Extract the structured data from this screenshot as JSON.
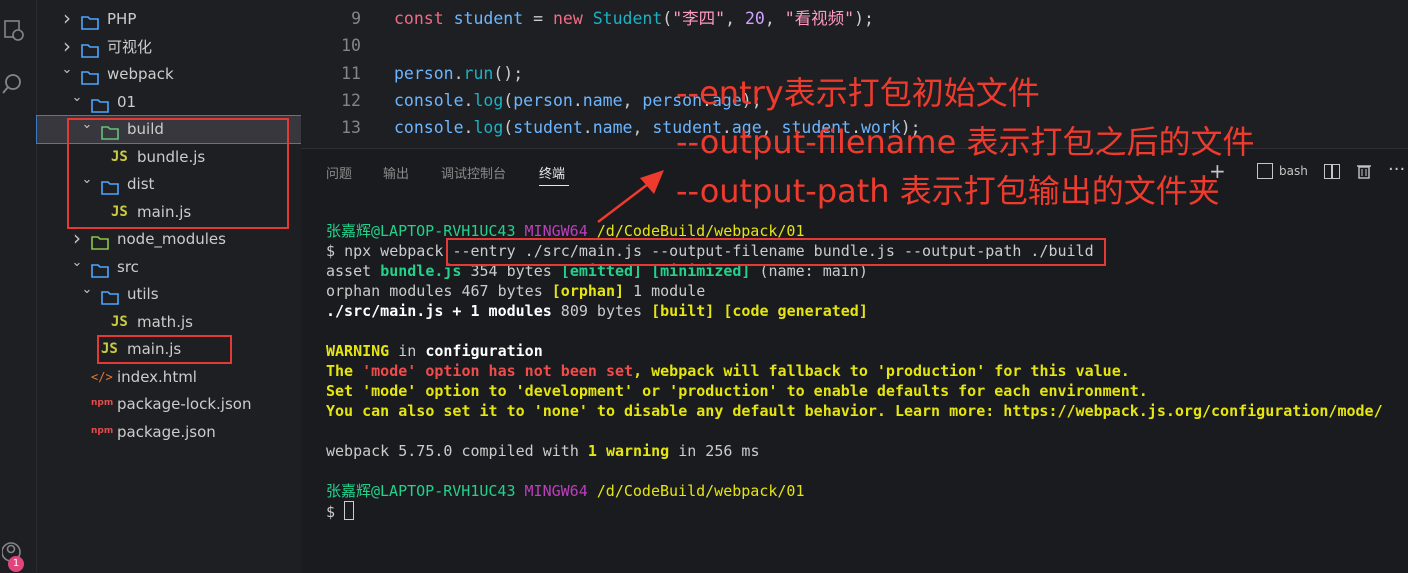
{
  "activity_bar": {
    "badge_count": "1"
  },
  "explorer": {
    "items": [
      {
        "label": "PHP",
        "kind": "folder",
        "state": "collapsed"
      },
      {
        "label": "可视化",
        "kind": "folder",
        "state": "collapsed"
      },
      {
        "label": "webpack",
        "kind": "folder",
        "state": "expanded"
      },
      {
        "label": "01",
        "kind": "folder",
        "state": "expanded"
      },
      {
        "label": "build",
        "kind": "folder",
        "state": "expanded"
      },
      {
        "label": "bundle.js",
        "kind": "js"
      },
      {
        "label": "dist",
        "kind": "folder",
        "state": "expanded"
      },
      {
        "label": "main.js",
        "kind": "js"
      },
      {
        "label": "node_modules",
        "kind": "folder",
        "state": "collapsed"
      },
      {
        "label": "src",
        "kind": "folder",
        "state": "expanded"
      },
      {
        "label": "utils",
        "kind": "folder",
        "state": "expanded"
      },
      {
        "label": "math.js",
        "kind": "js"
      },
      {
        "label": "main.js",
        "kind": "js"
      },
      {
        "label": "index.html",
        "kind": "html"
      },
      {
        "label": "package-lock.json",
        "kind": "npm"
      },
      {
        "label": "package.json",
        "kind": "npm"
      }
    ],
    "js_icon_text": "JS",
    "npm_icon_text": "npm"
  },
  "editor": {
    "lines": [
      {
        "num": "9",
        "tokens": [
          [
            "kw",
            "const "
          ],
          [
            "id",
            "student"
          ],
          [
            "pl",
            " = "
          ],
          [
            "kw",
            "new "
          ],
          [
            "cls",
            "Student"
          ],
          [
            "pl",
            "("
          ],
          [
            "str",
            "\"李四\""
          ],
          [
            "pl",
            ", "
          ],
          [
            "num",
            "20"
          ],
          [
            "pl",
            ", "
          ],
          [
            "str",
            "\"看视频\""
          ],
          [
            "pl",
            ");"
          ]
        ]
      },
      {
        "num": "10",
        "tokens": []
      },
      {
        "num": "11",
        "tokens": [
          [
            "id",
            "person"
          ],
          [
            "pl",
            "."
          ],
          [
            "fn",
            "run"
          ],
          [
            "pl",
            "();"
          ]
        ]
      },
      {
        "num": "12",
        "tokens": [
          [
            "id",
            "console"
          ],
          [
            "pl",
            "."
          ],
          [
            "fn",
            "log"
          ],
          [
            "pl",
            "("
          ],
          [
            "id",
            "person"
          ],
          [
            "pl",
            "."
          ],
          [
            "id",
            "name"
          ],
          [
            "pl",
            ", "
          ],
          [
            "id",
            "person"
          ],
          [
            "pl",
            "."
          ],
          [
            "id",
            "age"
          ],
          [
            "pl",
            ");"
          ]
        ]
      },
      {
        "num": "13",
        "tokens": [
          [
            "id",
            "console"
          ],
          [
            "pl",
            "."
          ],
          [
            "fn",
            "log"
          ],
          [
            "pl",
            "("
          ],
          [
            "id",
            "student"
          ],
          [
            "pl",
            "."
          ],
          [
            "id",
            "name"
          ],
          [
            "pl",
            ", "
          ],
          [
            "id",
            "student"
          ],
          [
            "pl",
            "."
          ],
          [
            "id",
            "age"
          ],
          [
            "pl",
            ", "
          ],
          [
            "id",
            "student"
          ],
          [
            "pl",
            "."
          ],
          [
            "id",
            "work"
          ],
          [
            "pl",
            ");"
          ]
        ]
      }
    ]
  },
  "panel": {
    "tabs": [
      "问题",
      "输出",
      "调试控制台",
      "终端"
    ],
    "active_tab": "终端",
    "shell_label": "bash",
    "add_glyph": "+",
    "terminal": {
      "prompt1_user": "张嘉辉@LAPTOP-RVH1UC43",
      "prompt1_env": "MINGW64",
      "prompt1_path": "/d/CodeBuild/webpack/01",
      "cmd_dollar": "$",
      "cmd_head": "npx webpack",
      "cmd_args": "--entry ./src/main.js --output-filename bundle.js --output-path ./build",
      "l_asset_1": "asset ",
      "l_asset_file": "bundle.js",
      "l_asset_2": " 354 bytes ",
      "l_asset_emitted": "[emitted]",
      "l_asset_min": "[minimized]",
      "l_asset_3": " (name: main)",
      "l_orphan_1": "orphan modules 467 bytes ",
      "l_orphan_tag": "[orphan]",
      "l_orphan_2": " 1 module",
      "l_src_1": "./src/main.js + 1 modules",
      "l_src_2": " 809 bytes ",
      "l_src_built": "[built]",
      "l_src_gen": "[code generated]",
      "warn_1": "WARNING",
      "warn_2": " in ",
      "warn_3": "configuration",
      "w1_a": "The ",
      "w1_b": "'mode' option has not been set",
      "w1_c": ", webpack will fallback to 'production' for this value.",
      "w2": "Set 'mode' option to 'development' or 'production' to enable defaults for each environment.",
      "w3": "You can also set it to 'none' to disable any default behavior. Learn more: https://webpack.js.org/configuration/mode/",
      "c_1": "webpack 5.75.0 compiled with ",
      "c_2": "1 warning",
      "c_3": " in 256 ms",
      "prompt2_user": "张嘉辉@LAPTOP-RVH1UC43",
      "prompt2_env": "MINGW64",
      "prompt2_path": "/d/CodeBuild/webpack/01",
      "prompt2_dollar": "$"
    }
  },
  "annotations": {
    "entry": "--entry表示打包初始文件",
    "filename": "--output-filename 表示打包之后的文件",
    "path": "--output-path 表示打包输出的文件夹"
  },
  "colors": {
    "annotation_red": "#ef3b2d",
    "terminal_green": "#23d18b",
    "terminal_magenta": "#bc3fbc",
    "terminal_yellow": "#e5e510"
  }
}
